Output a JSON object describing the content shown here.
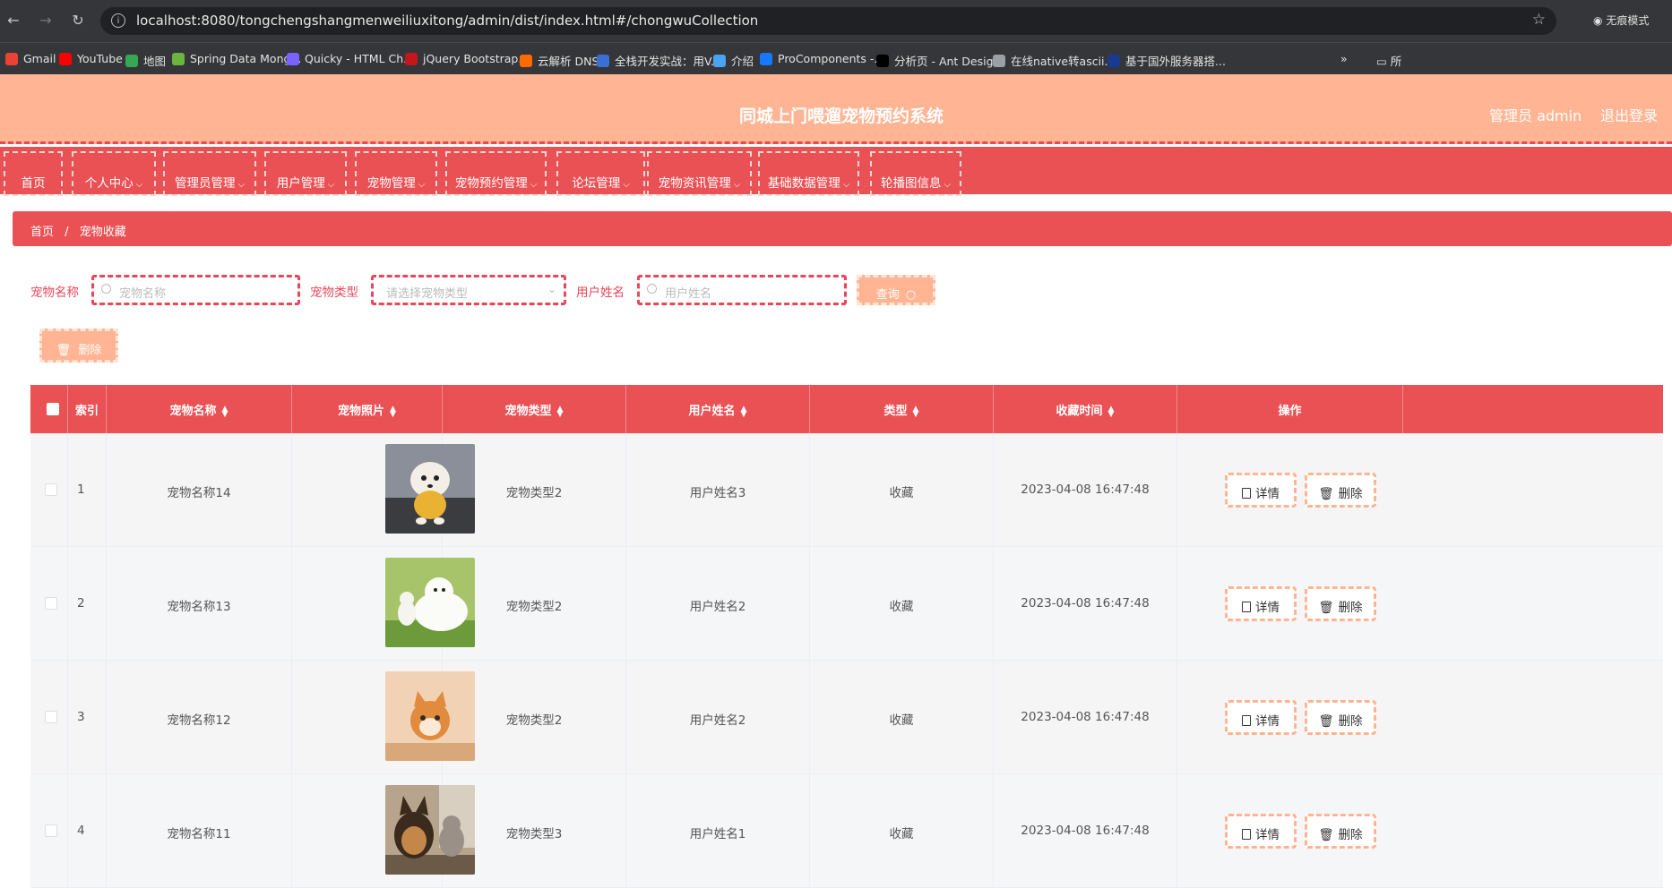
{
  "browser": {
    "url": "localhost:8080/tongchengshangmenweiliuxitong/admin/dist/index.html#/chongwuCollection",
    "mode_label": "无痕模式",
    "bookmarks": [
      {
        "label": "Gmail",
        "icon": "gmail-icon",
        "color": "#ea4335"
      },
      {
        "label": "YouTube",
        "icon": "youtube-icon",
        "color": "#ff0000"
      },
      {
        "label": "地图",
        "icon": "maps-icon",
        "color": "#34a853"
      },
      {
        "label": "Spring Data Mong...",
        "icon": "spring-icon",
        "color": "#6db33f"
      },
      {
        "label": "Quicky - HTML Ch...",
        "icon": "quicky-icon",
        "color": "#7b61ff"
      },
      {
        "label": "jQuery Bootstrap...",
        "icon": "jquery-icon",
        "color": "#c4161c"
      },
      {
        "label": "云解析 DNS",
        "icon": "aliyun-icon",
        "color": "#ff6a00"
      },
      {
        "label": "全栈开发实战：用V...",
        "icon": "m-icon",
        "color": "#3b6fd6"
      },
      {
        "label": "介绍",
        "icon": "globe-icon",
        "color": "#4aa3f0"
      },
      {
        "label": "ProComponents -...",
        "icon": "procomponents-icon",
        "color": "#1677ff"
      },
      {
        "label": "分析页 - Ant Desig...",
        "icon": "pro-icon",
        "color": "#000000"
      },
      {
        "label": "在线native转ascii...",
        "icon": "web-icon",
        "color": "#9aa0a6"
      },
      {
        "label": "基于国外服务器搭...",
        "icon": "flag-icon",
        "color": "#1a3a8f"
      }
    ],
    "more_label": "»",
    "folder_label": "所"
  },
  "header": {
    "title": "同城上门喂遛宠物预约系统",
    "admin_label": "管理员 admin",
    "logout_label": "退出登录"
  },
  "menu": [
    {
      "label": "首页",
      "dropdown": false
    },
    {
      "label": "个人中心",
      "dropdown": true
    },
    {
      "label": "管理员管理",
      "dropdown": true
    },
    {
      "label": "用户管理",
      "dropdown": true
    },
    {
      "label": "宠物管理",
      "dropdown": true
    },
    {
      "label": "宠物预约管理",
      "dropdown": true
    },
    {
      "label": "论坛管理",
      "dropdown": true
    },
    {
      "label": "宠物资讯管理",
      "dropdown": true
    },
    {
      "label": "基础数据管理",
      "dropdown": true
    },
    {
      "label": "轮播图信息",
      "dropdown": true
    }
  ],
  "breadcrumb": {
    "home": "首页",
    "separator": "/",
    "current": "宠物收藏"
  },
  "search": {
    "pet_name_label": "宠物名称",
    "pet_name_placeholder": "宠物名称",
    "pet_type_label": "宠物类型",
    "pet_type_placeholder": "请选择宠物类型",
    "user_name_label": "用户姓名",
    "user_name_placeholder": "用户姓名",
    "query_label": "查询"
  },
  "toolbar": {
    "delete_label": "删除"
  },
  "table": {
    "headers": [
      "索引",
      "宠物名称",
      "宠物照片",
      "宠物类型",
      "用户姓名",
      "类型",
      "收藏时间",
      "操作"
    ],
    "rows": [
      {
        "index": "1",
        "pet_name": "宠物名称14",
        "pet_type": "宠物类型2",
        "user_name": "用户姓名3",
        "type": "收藏",
        "time": "2023-04-08 16:47:48",
        "photo": "white-puppy-photo"
      },
      {
        "index": "2",
        "pet_name": "宠物名称13",
        "pet_type": "宠物类型2",
        "user_name": "用户姓名2",
        "type": "收藏",
        "time": "2023-04-08 16:47:48",
        "photo": "samoyed-photo"
      },
      {
        "index": "3",
        "pet_name": "宠物名称12",
        "pet_type": "宠物类型2",
        "user_name": "用户姓名2",
        "type": "收藏",
        "time": "2023-04-08 16:47:48",
        "photo": "kitten-photo"
      },
      {
        "index": "4",
        "pet_name": "宠物名称11",
        "pet_type": "宠物类型3",
        "user_name": "用户姓名1",
        "type": "收藏",
        "time": "2023-04-08 16:47:48",
        "photo": "dog-and-cat-photo"
      }
    ],
    "detail_label": "详情",
    "delete_label": "删除"
  },
  "colors": {
    "accent": "#ea5155",
    "header_bg": "#ffb493",
    "dashed_border": "#e8475a"
  }
}
